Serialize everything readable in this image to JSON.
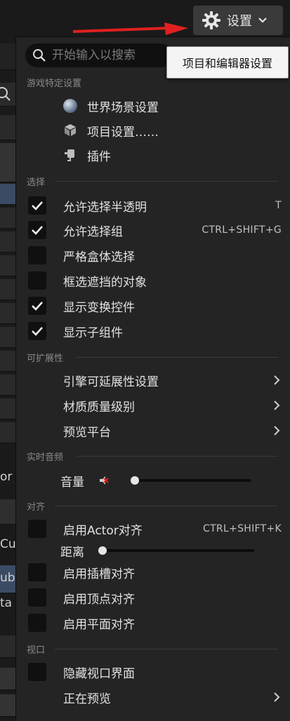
{
  "settings_button": {
    "label": "设置",
    "icon": "gear-icon",
    "chevron": "chevron-down-icon"
  },
  "search": {
    "placeholder": "开始输入以搜索"
  },
  "tooltip": "项目和编辑器设置",
  "sections": {
    "game_specific": "游戏特定设置",
    "selection": "选择",
    "scalability": "可扩展性",
    "realtime_audio": "实时音频",
    "snapping": "对齐",
    "viewport": "视口"
  },
  "game_items": [
    {
      "label": "世界场景设置",
      "icon": "globe-icon"
    },
    {
      "label": "项目设置……",
      "icon": "project-settings-icon"
    },
    {
      "label": "插件",
      "icon": "plugin-icon"
    }
  ],
  "selection_items": [
    {
      "label": "允许选择半透明",
      "checked": true,
      "shortcut": "T"
    },
    {
      "label": "允许选择组",
      "checked": true,
      "shortcut": "CTRL+SHIFT+G"
    },
    {
      "label": "严格盒体选择",
      "checked": false,
      "shortcut": ""
    },
    {
      "label": "框选遮挡的对象",
      "checked": false,
      "shortcut": ""
    },
    {
      "label": "显示变换控件",
      "checked": true,
      "shortcut": ""
    },
    {
      "label": "显示子组件",
      "checked": true,
      "shortcut": ""
    }
  ],
  "scalability_items": [
    {
      "label": "引擎可延展性设置"
    },
    {
      "label": "材质质量级别"
    },
    {
      "label": "预览平台"
    }
  ],
  "audio": {
    "volume_label": "音量",
    "icon": "speaker-muted-icon",
    "volume_level": 0
  },
  "snapping": {
    "actor_snap": {
      "label": "启用Actor对齐",
      "checked": false,
      "shortcut": "CTRL+SHIFT+K"
    },
    "distance_label": "距离",
    "distance_level": 0,
    "socket_snap": {
      "label": "启用插槽对齐",
      "checked": false
    },
    "vertex_snap": {
      "label": "启用顶点对齐",
      "checked": false
    },
    "plane_snap": {
      "label": "启用平面对齐",
      "checked": false
    }
  },
  "viewport_items": {
    "hide_ui": {
      "label": "隐藏视口界面",
      "checked": false
    },
    "previewing": {
      "label": "正在预览"
    }
  },
  "background": {
    "partial_text": [
      "or (",
      "Cu",
      "ub",
      "ta"
    ]
  },
  "colors": {
    "menu_bg": "#242424",
    "accent_red": "#e02020",
    "selected_row": "#3b4b63"
  }
}
